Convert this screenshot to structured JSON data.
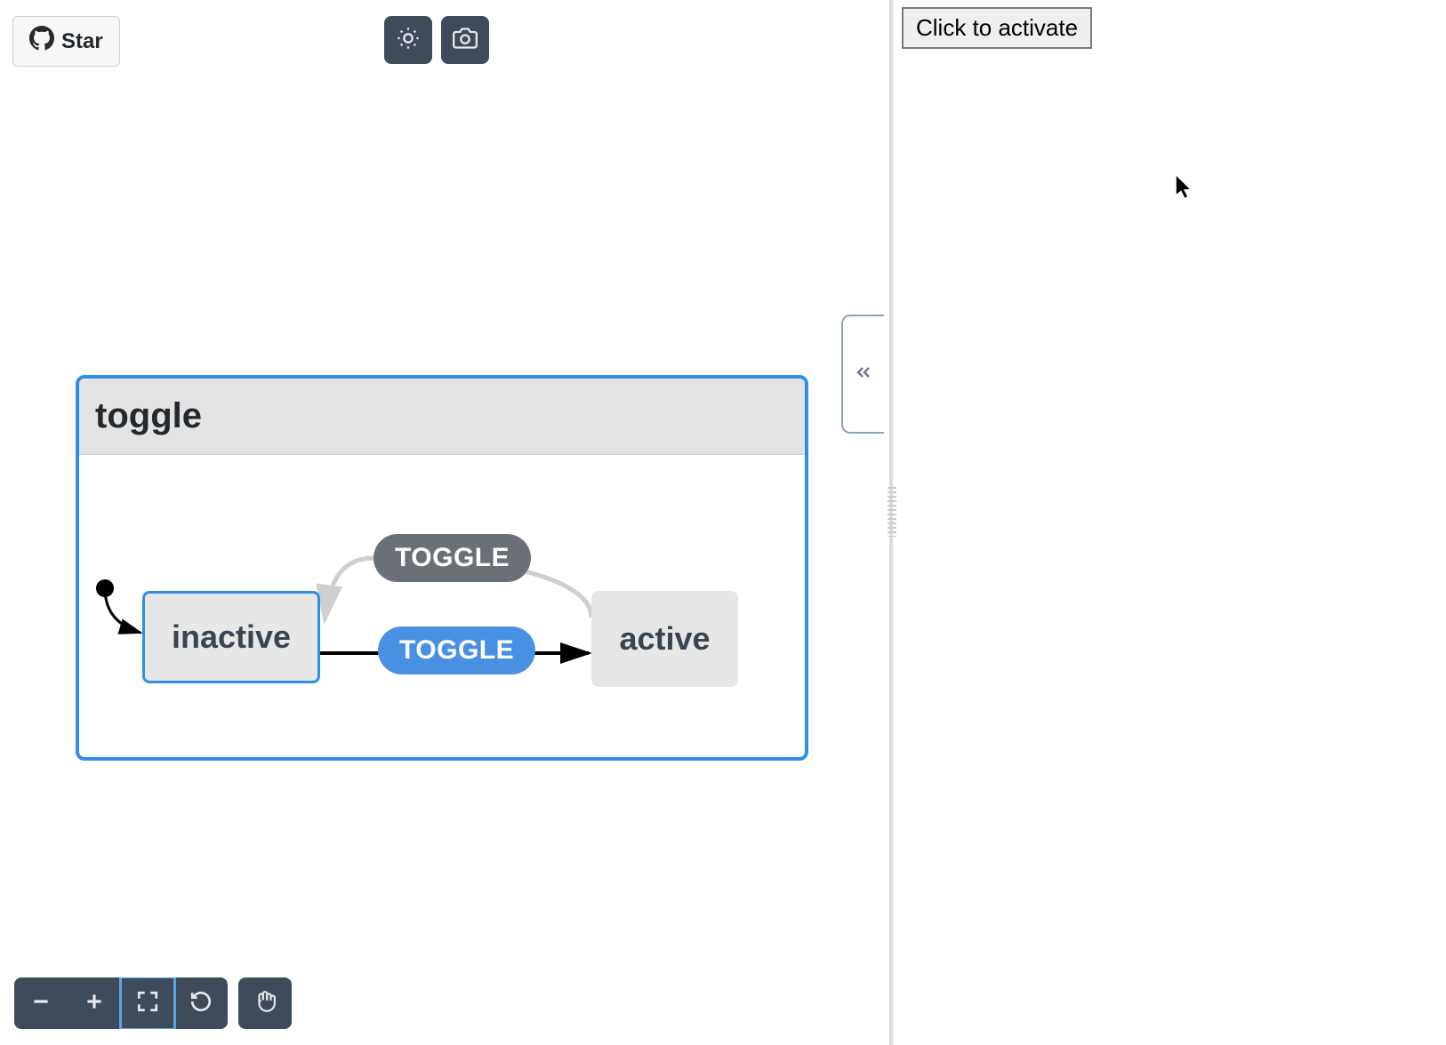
{
  "header": {
    "star_label": "Star"
  },
  "machine": {
    "title": "toggle",
    "states": {
      "inactive": "inactive",
      "active": "active"
    },
    "events": {
      "toggle_back": "TOGGLE",
      "toggle_forward": "TOGGLE"
    }
  },
  "right_panel": {
    "activate_label": "Click to activate"
  },
  "icons": {
    "github": "github-icon",
    "sun": "sun-icon",
    "camera": "camera-icon",
    "chevrons_left": "chevrons-left-icon",
    "minus": "minus-icon",
    "plus": "plus-icon",
    "fit": "fit-icon",
    "reset": "reset-icon",
    "hand": "hand-icon"
  },
  "colors": {
    "accent": "#2f8ee6",
    "dark_button": "#3f4b5b",
    "pill_gray": "#6b6f76",
    "pill_blue": "#4a90e2"
  }
}
